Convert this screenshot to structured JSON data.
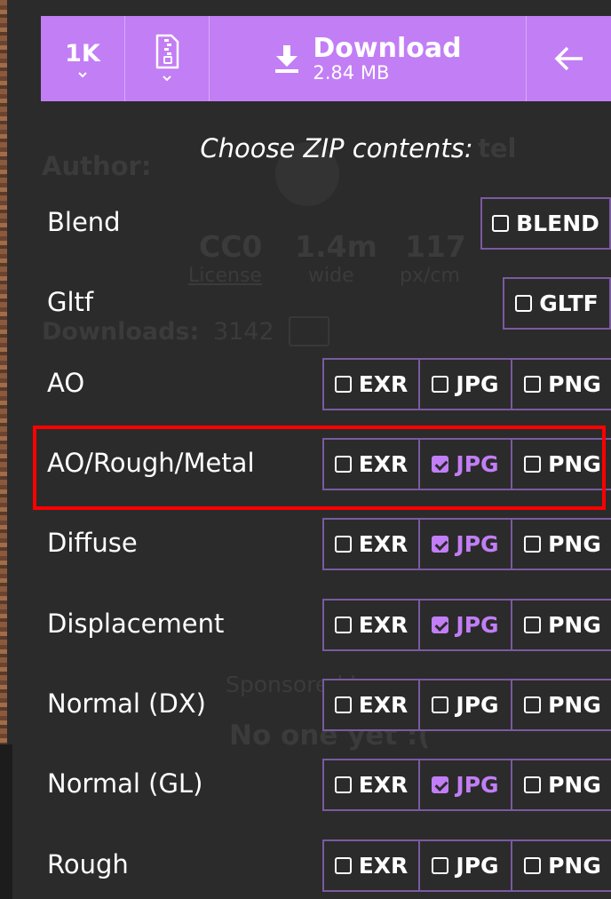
{
  "toolbar": {
    "resolution": "1K",
    "download_title": "Download",
    "download_size": "2.84 MB",
    "icons": [
      "chevron-down-icon",
      "zip-file-icon",
      "download-icon",
      "arrow-left-icon"
    ]
  },
  "background": {
    "author_label": "Author:",
    "name_fragment": "tel",
    "license_value": "CC0",
    "license_label": "License",
    "width_value": "1.4m",
    "width_label": "wide",
    "density_value": "117",
    "density_label": "px/cm",
    "downloads_label": "Downloads:",
    "downloads_count": "3142",
    "sponsored_label": "Sponsored by:",
    "sponsor_value": "No one yet :("
  },
  "heading": "Choose ZIP contents:",
  "rows": [
    {
      "label": "Blend",
      "options": [
        {
          "label": "BLEND",
          "checked": false
        }
      ]
    },
    {
      "label": "Gltf",
      "options": [
        {
          "label": "GLTF",
          "checked": false
        }
      ]
    },
    {
      "label": "AO",
      "options": [
        {
          "label": "EXR",
          "checked": false
        },
        {
          "label": "JPG",
          "checked": false
        },
        {
          "label": "PNG",
          "checked": false
        }
      ]
    },
    {
      "label": "AO/Rough/Metal",
      "options": [
        {
          "label": "EXR",
          "checked": false
        },
        {
          "label": "JPG",
          "checked": true
        },
        {
          "label": "PNG",
          "checked": false
        }
      ]
    },
    {
      "label": "Diffuse",
      "options": [
        {
          "label": "EXR",
          "checked": false
        },
        {
          "label": "JPG",
          "checked": true
        },
        {
          "label": "PNG",
          "checked": false
        }
      ]
    },
    {
      "label": "Displacement",
      "options": [
        {
          "label": "EXR",
          "checked": false
        },
        {
          "label": "JPG",
          "checked": true
        },
        {
          "label": "PNG",
          "checked": false
        }
      ]
    },
    {
      "label": "Normal (DX)",
      "options": [
        {
          "label": "EXR",
          "checked": false
        },
        {
          "label": "JPG",
          "checked": false
        },
        {
          "label": "PNG",
          "checked": false
        }
      ]
    },
    {
      "label": "Normal (GL)",
      "options": [
        {
          "label": "EXR",
          "checked": false
        },
        {
          "label": "JPG",
          "checked": true
        },
        {
          "label": "PNG",
          "checked": false
        }
      ]
    },
    {
      "label": "Rough",
      "options": [
        {
          "label": "EXR",
          "checked": false
        },
        {
          "label": "JPG",
          "checked": false
        },
        {
          "label": "PNG",
          "checked": false
        }
      ]
    }
  ],
  "colors": {
    "accent": "#c27ef5",
    "background": "#2b2b2b",
    "option_border": "#7a5aa0",
    "highlight": "#ff0000"
  }
}
